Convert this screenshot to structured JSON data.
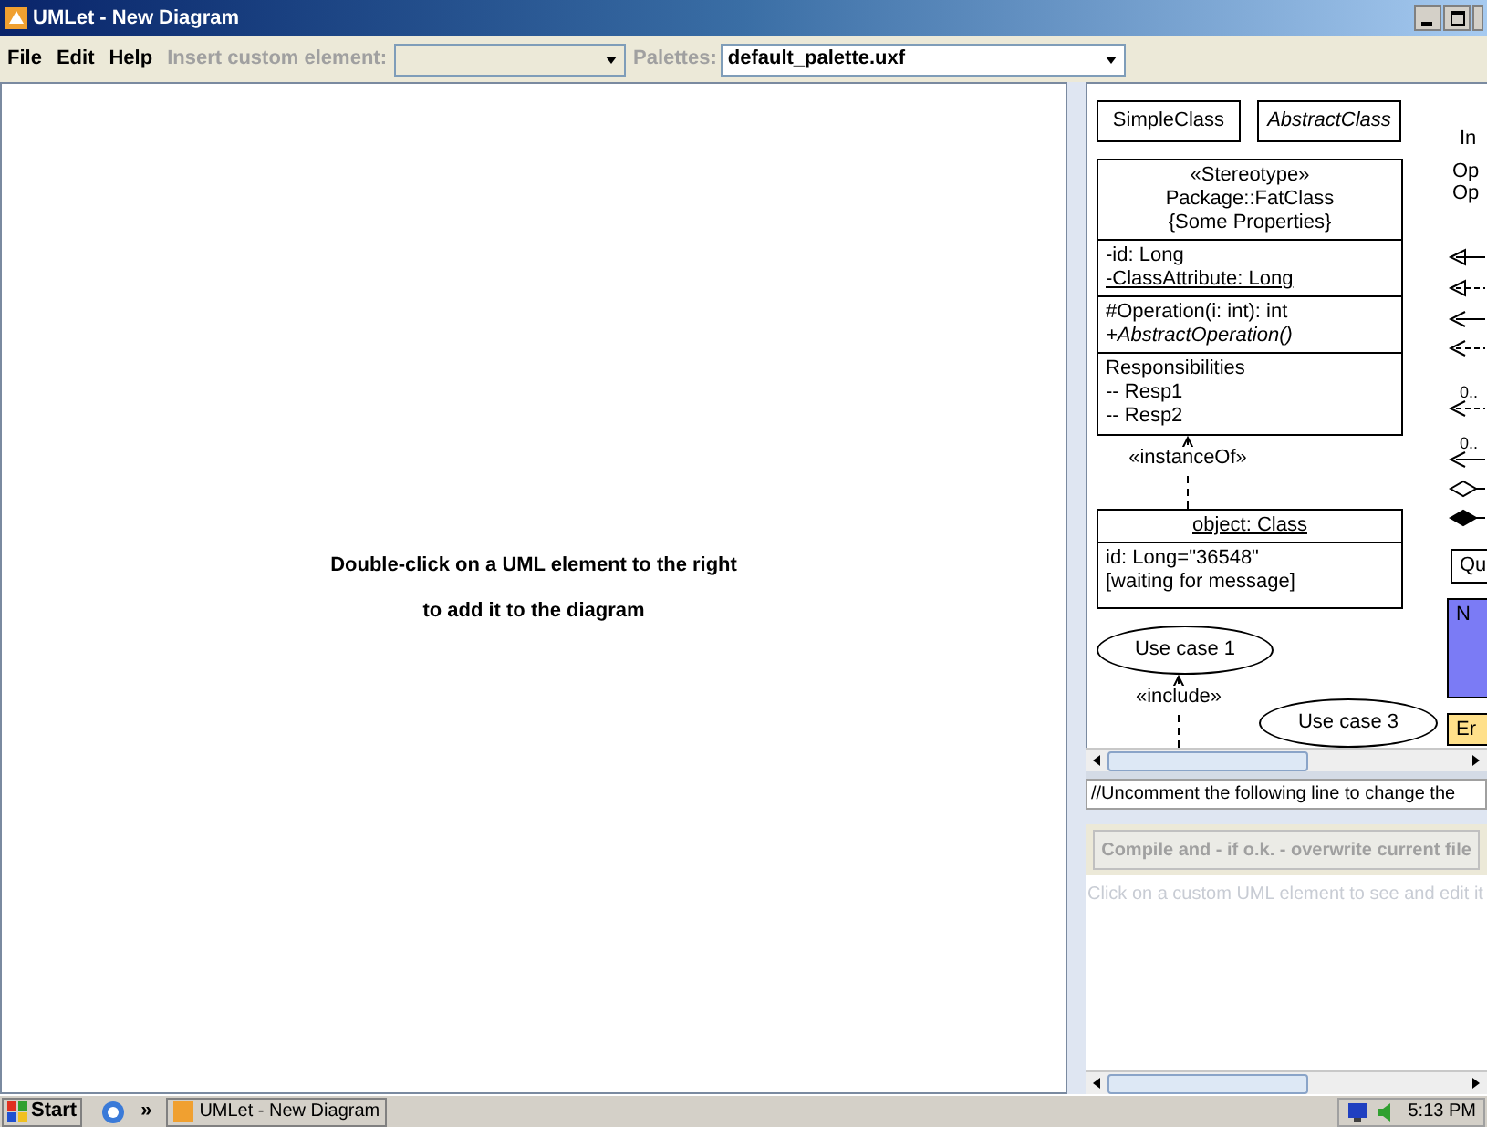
{
  "window": {
    "title": "UMLet - New Diagram"
  },
  "menu": [
    {
      "label": "File"
    },
    {
      "label": "Edit"
    },
    {
      "label": "Help"
    }
  ],
  "toolbar": {
    "insert_label": {
      "text": "Insert custom element:",
      "disabled": true
    },
    "palettes_label": {
      "text": "Palettes:",
      "disabled": true
    },
    "palette_combo": {
      "value": "default_palette.uxf"
    }
  },
  "diagram": {
    "hint_lines": [
      "Double-click on a UML element to the right",
      "to add it to the diagram"
    ]
  },
  "palette": {
    "elements": [
      {
        "kind": "class",
        "header": [
          {
            "text": "SimpleClass",
            "italic": false,
            "underline": false
          }
        ]
      },
      {
        "kind": "class",
        "header": [
          {
            "text": "AbstractClass",
            "italic": true,
            "underline": false
          }
        ]
      },
      {
        "kind": "class",
        "header": [
          {
            "text": "«Stereotype»",
            "italic": false,
            "underline": false
          },
          {
            "text": "Package::FatClass",
            "italic": false,
            "underline": false
          },
          {
            "text": "{Some Properties}",
            "italic": false,
            "underline": false
          }
        ],
        "sections": [
          [
            {
              "text": "-id: Long",
              "italic": false,
              "underline": false
            },
            {
              "text": "-ClassAttribute: Long",
              "italic": false,
              "underline": true
            }
          ],
          [
            {
              "text": "#Operation(i: int): int",
              "italic": false,
              "underline": false
            },
            {
              "text": "+AbstractOperation()",
              "italic": true,
              "underline": false
            }
          ],
          [
            {
              "text": "Responsibilities",
              "italic": false,
              "underline": false
            },
            {
              "text": "-- Resp1",
              "italic": false,
              "underline": false
            },
            {
              "text": "-- Resp2",
              "italic": false,
              "underline": false
            }
          ]
        ]
      },
      {
        "kind": "relation",
        "label": "«instanceOf»"
      },
      {
        "kind": "object",
        "header": [
          {
            "text": "object: Class",
            "italic": false,
            "underline": true
          }
        ],
        "sections": [
          [
            {
              "text": "id: Long=\"36548\"",
              "italic": false,
              "underline": false
            },
            {
              "text": "[waiting for message]",
              "italic": false,
              "underline": false
            }
          ]
        ]
      },
      {
        "kind": "use_case",
        "label": "Use case 1"
      },
      {
        "kind": "relation",
        "label": "«include»"
      },
      {
        "kind": "use_case",
        "label": "Use case 3"
      },
      {
        "kind": "text",
        "label": "In"
      },
      {
        "kind": "text",
        "label": "Op"
      },
      {
        "kind": "text",
        "label": "Op"
      },
      {
        "kind": "triangle_arrow",
        "dashed": false
      },
      {
        "kind": "triangle_arrow",
        "dashed": true
      },
      {
        "kind": "open_arrow",
        "dashed": false
      },
      {
        "kind": "open_arrow",
        "dashed": true
      },
      {
        "kind": "open_arrow",
        "dashed": true,
        "label": "0.."
      },
      {
        "kind": "open_arrow",
        "dashed": false,
        "label": "0.."
      },
      {
        "kind": "hollow_diamond",
        "dashed": false
      },
      {
        "kind": "filled_diamond",
        "dashed": false
      },
      {
        "kind": "box",
        "label": "Qu",
        "color": "#ffffff"
      },
      {
        "kind": "box",
        "label": "N",
        "color": "#7b7bf5"
      },
      {
        "kind": "box",
        "label": "Er",
        "color": "#ffe08a"
      }
    ]
  },
  "editor": {
    "code_line": "//Uncomment the following line to change the",
    "compile_button": {
      "label": "Compile and - if o.k. - overwrite current file",
      "disabled": true
    },
    "hint": "Click on a custom UML element to see and edit it"
  },
  "taskbar": {
    "start": "Start",
    "more": "»",
    "tasks": [
      {
        "label": "UMLet - New Diagram",
        "selected": false
      }
    ],
    "clock": "5:13 PM"
  }
}
